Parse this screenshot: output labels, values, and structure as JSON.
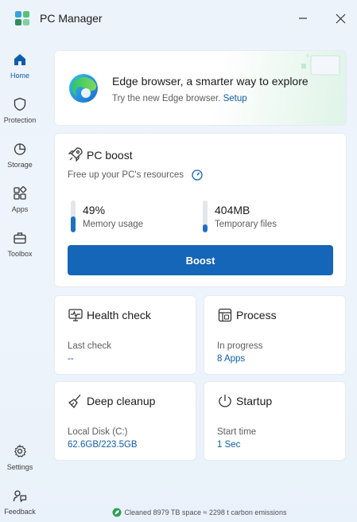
{
  "app": {
    "title": "PC Manager"
  },
  "window": {
    "minimize_icon": "minimize-icon",
    "close_icon": "close-icon"
  },
  "sidebar": {
    "items": [
      {
        "label": "Home",
        "icon": "home-icon",
        "active": true
      },
      {
        "label": "Protection",
        "icon": "shield-icon",
        "active": false
      },
      {
        "label": "Storage",
        "icon": "pie-chart-icon",
        "active": false
      },
      {
        "label": "Apps",
        "icon": "apps-grid-icon",
        "active": false
      },
      {
        "label": "Toolbox",
        "icon": "toolbox-icon",
        "active": false
      },
      {
        "label": "Settings",
        "icon": "gear-icon",
        "active": false
      },
      {
        "label": "Feedback",
        "icon": "feedback-icon",
        "active": false
      }
    ]
  },
  "banner": {
    "title": "Edge browser, a smarter way to explore",
    "subtitle": "Try the new Edge browser.",
    "link": "Setup"
  },
  "boost": {
    "title": "PC boost",
    "subtitle": "Free up your PC's resources",
    "memory": {
      "value": "49%",
      "label": "Memory usage",
      "fill": 0.49
    },
    "temp": {
      "value": "404MB",
      "label": "Temporary files",
      "fill": 0.25
    },
    "button": "Boost"
  },
  "tiles": {
    "health": {
      "title": "Health check",
      "label": "Last check",
      "value": "--"
    },
    "process": {
      "title": "Process",
      "label": "In progress",
      "value": "8 Apps"
    },
    "cleanup": {
      "title": "Deep cleanup",
      "label": "Local Disk (C:)",
      "value": "62.6GB/223.5GB"
    },
    "startup": {
      "title": "Startup",
      "label": "Start time",
      "value": "1 Sec"
    }
  },
  "footer": {
    "text": "Cleaned 8979 TB space ≈ 2298 t carbon emissions"
  },
  "colors": {
    "accent": "#1565b8",
    "link": "#0f5cab",
    "active_nav": "#0f5cab"
  }
}
